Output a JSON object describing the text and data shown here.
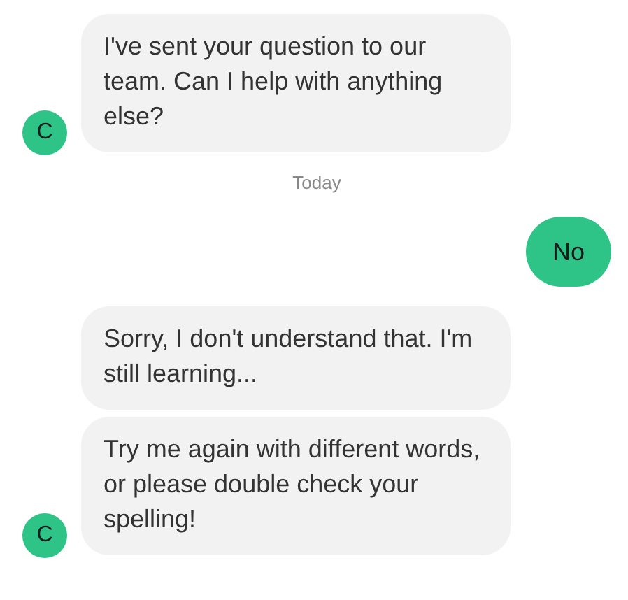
{
  "messages": [
    {
      "kind": "bot",
      "text": "I've sent your question to our team. Can I help with anything else?",
      "avatar": "C"
    },
    {
      "kind": "date",
      "text": "Today"
    },
    {
      "kind": "user",
      "text": "No"
    },
    {
      "kind": "bot",
      "text": "Sorry, I don't understand that. I'm still learning..."
    },
    {
      "kind": "bot",
      "text": "Try me again with different words, or please double check your spelling!",
      "avatar": "C"
    }
  ]
}
